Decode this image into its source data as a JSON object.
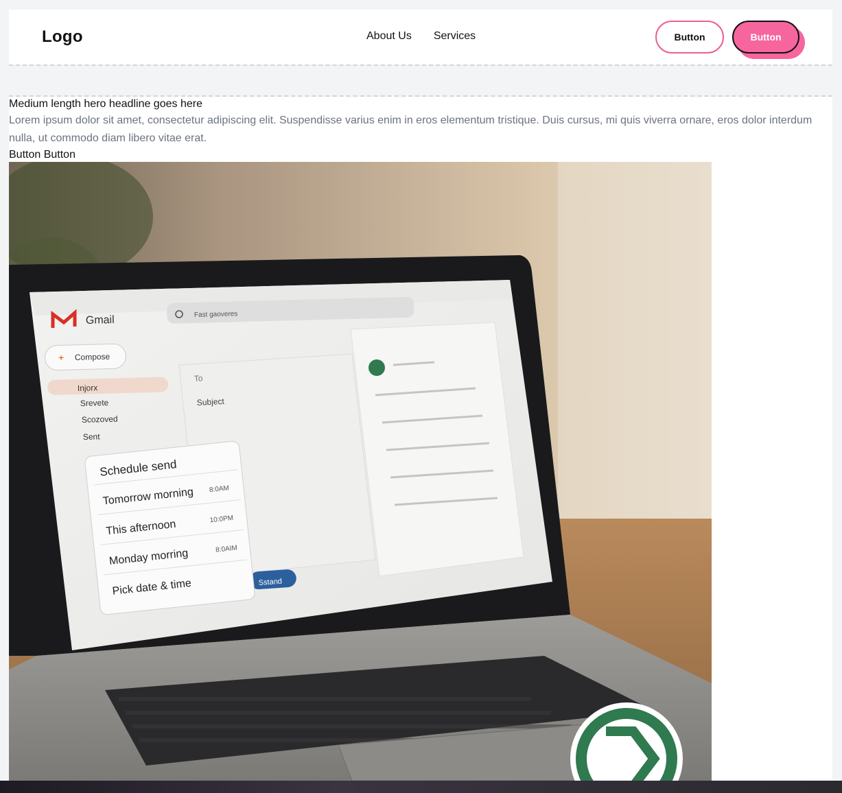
{
  "nav": {
    "logo": "Logo",
    "links": [
      "About Us",
      "Services"
    ],
    "button_outline": "Button",
    "button_fill": "Button"
  },
  "hero": {
    "headline": "Medium length hero headline goes here",
    "description": "Lorem ipsum dolor sit amet, consectetur adipiscing elit. Suspendisse varius enim in eros elementum tristique. Duis cursus, mi quis viverra ornare, eros dolor interdum nulla, ut commodo diam libero vitae erat.",
    "buttons": "Button Button"
  },
  "photo": {
    "app_name": "Gmail",
    "search_text": "Fast gaoveres",
    "compose_label": "Compose",
    "sidebar_items": [
      "Injorx",
      "Srevete",
      "Scozoved",
      "Sent"
    ],
    "to_label": "To",
    "subject_label": "Subject",
    "send_label": "Sstand",
    "schedule": {
      "title": "Schedule send",
      "options": [
        {
          "label": "Tomorrow morning",
          "time": "8:0AM"
        },
        {
          "label": "This afternoon",
          "time": "10:0PM"
        },
        {
          "label": "Monday morring",
          "time": "8:0AIM"
        },
        {
          "label": "Pick date & time",
          "time": ""
        }
      ]
    },
    "colors": {
      "gmail_red": "#d93025",
      "openai_green": "#2f7a4f",
      "accent_pink": "#f7659e"
    }
  }
}
